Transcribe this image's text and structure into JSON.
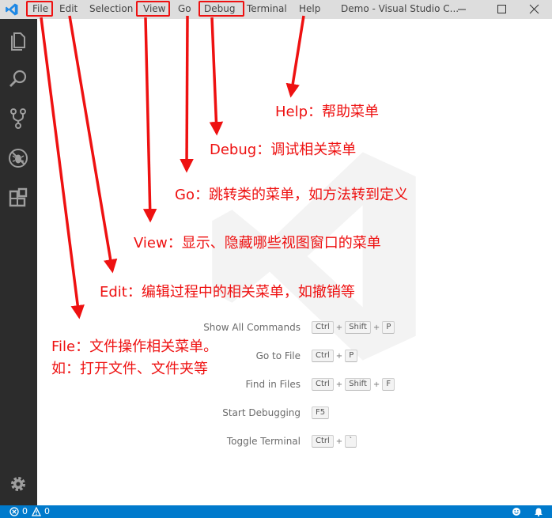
{
  "titlebar": {
    "menu": [
      {
        "id": "file",
        "label": "File"
      },
      {
        "id": "edit",
        "label": "Edit"
      },
      {
        "id": "selection",
        "label": "Selection"
      },
      {
        "id": "view",
        "label": "View"
      },
      {
        "id": "go",
        "label": "Go"
      },
      {
        "id": "debug",
        "label": "Debug"
      },
      {
        "id": "terminal",
        "label": "Terminal"
      },
      {
        "id": "help",
        "label": "Help"
      }
    ],
    "window_title": "Demo - Visual Studio C..."
  },
  "activitybar": {
    "icons": [
      "explorer-icon",
      "search-icon",
      "source-control-icon",
      "debug-icon",
      "extensions-icon"
    ],
    "bottom_icon": "gear-icon"
  },
  "shortcuts": [
    {
      "label": "Show All Commands",
      "keys": [
        "Ctrl",
        "Shift",
        "P"
      ]
    },
    {
      "label": "Go to File",
      "keys": [
        "Ctrl",
        "P"
      ]
    },
    {
      "label": "Find in Files",
      "keys": [
        "Ctrl",
        "Shift",
        "F"
      ]
    },
    {
      "label": "Start Debugging",
      "keys": [
        "F5"
      ]
    },
    {
      "label": "Toggle Terminal",
      "keys": [
        "Ctrl",
        "`"
      ]
    }
  ],
  "statusbar": {
    "errors": "0",
    "warnings": "0"
  },
  "annotations": {
    "help": "Help：帮助菜单",
    "debug": "Debug：调试相关菜单",
    "go": "Go：跳转类的菜单，如方法转到定义",
    "view": "View：显示、隐藏哪些视图窗口的菜单",
    "edit": "Edit：编辑过程中的相关菜单，如撤销等",
    "file_line1": "File：文件操作相关菜单。",
    "file_line2": "如：打开文件、文件夹等"
  },
  "colors": {
    "annotation": "#ee1111",
    "statusbar": "#007acc",
    "activitybar": "#2c2c2c",
    "titlebar": "#dddddd"
  }
}
